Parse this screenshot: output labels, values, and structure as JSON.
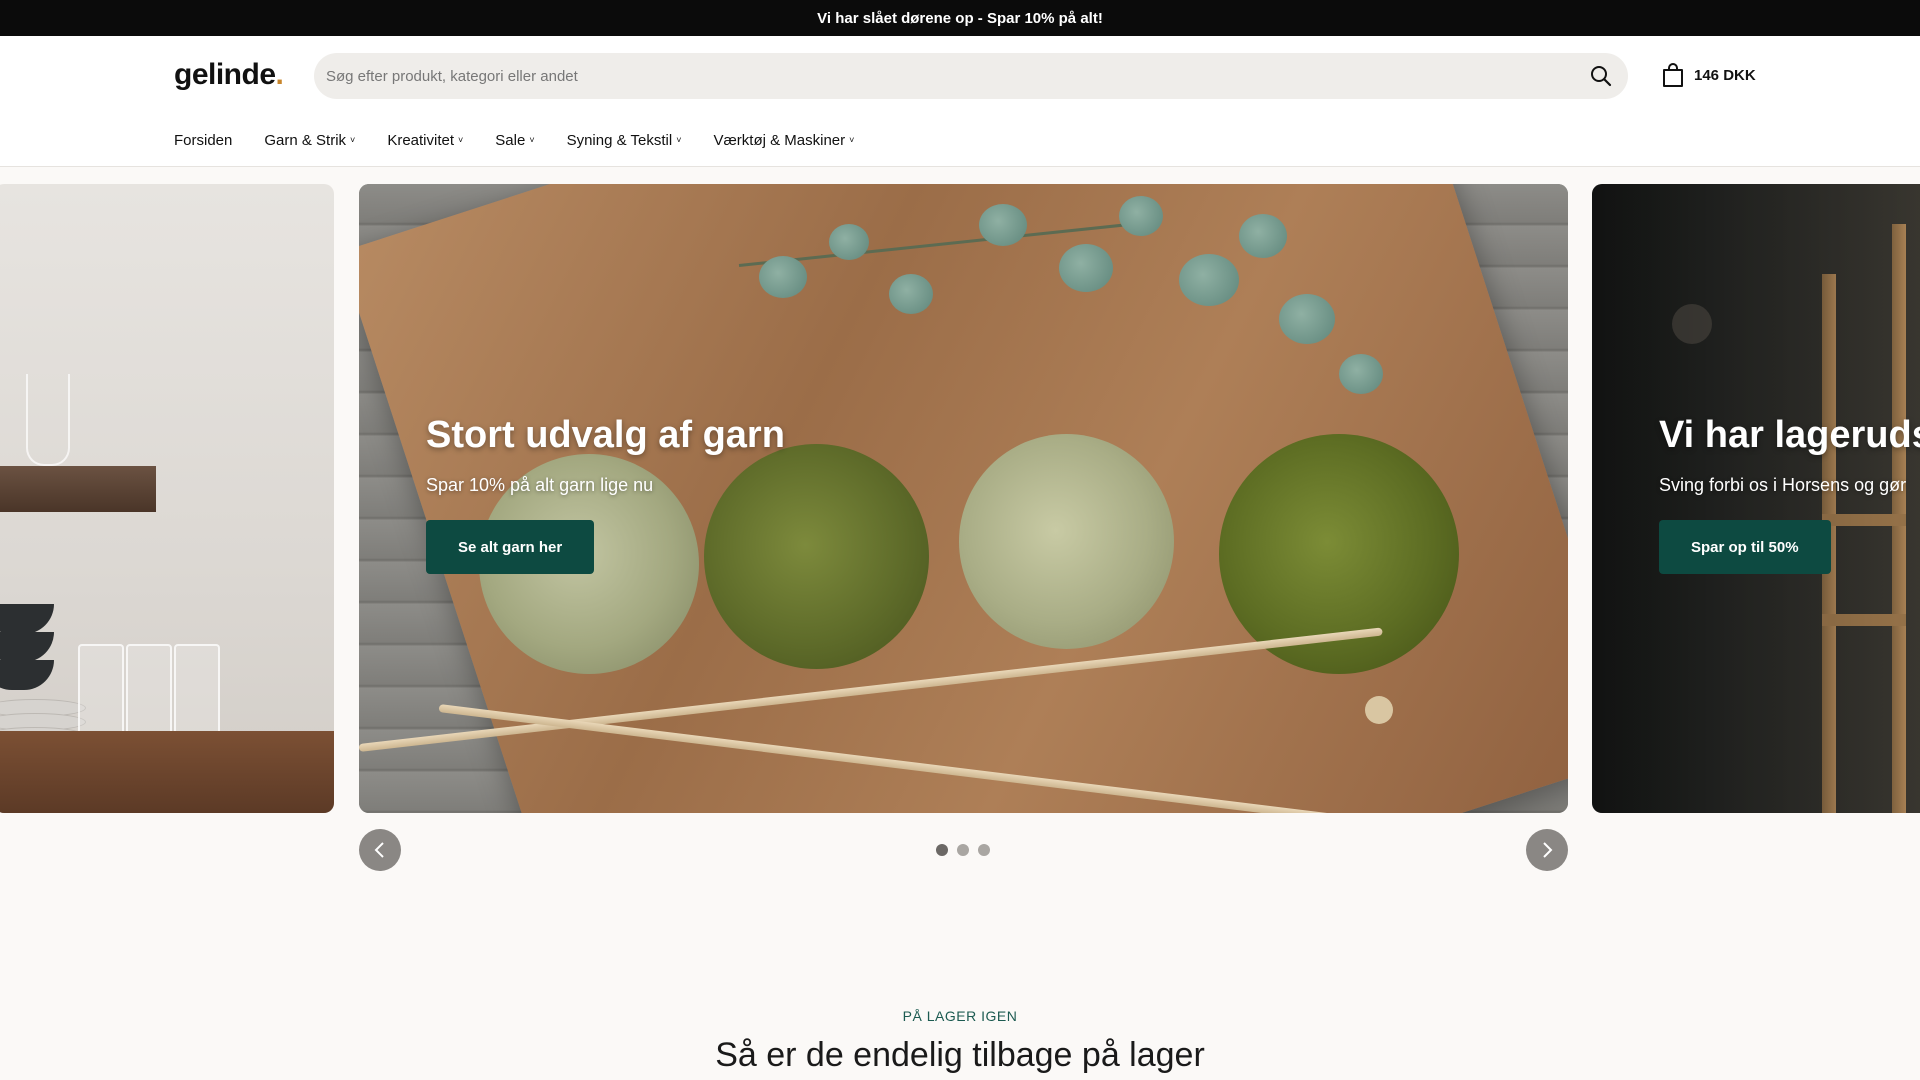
{
  "announcement": "Vi har slået dørene op - Spar 10% på alt!",
  "header": {
    "logo": "gelinde",
    "logo_dot": ".",
    "search_placeholder": "Søg efter produkt, kategori eller andet",
    "cart_total": "146 DKK"
  },
  "nav": [
    {
      "label": "Forsiden",
      "has_dropdown": false
    },
    {
      "label": "Garn & Strik",
      "has_dropdown": true
    },
    {
      "label": "Kreativitet",
      "has_dropdown": true
    },
    {
      "label": "Sale",
      "has_dropdown": true
    },
    {
      "label": "Syning & Tekstil",
      "has_dropdown": true
    },
    {
      "label": "Værktøj & Maskiner",
      "has_dropdown": true
    }
  ],
  "slides": {
    "main": {
      "title": "Stort udvalg af garn",
      "subtitle": "Spar 10% på alt garn lige nu",
      "button": "Se alt garn her"
    },
    "next": {
      "title": "Vi har lageruds",
      "subtitle": "Sving forbi os i Horsens og gør",
      "button": "Spar op til 50%"
    }
  },
  "carousel": {
    "dot_count": 3,
    "active_dot": 1
  },
  "section": {
    "eyebrow": "PÅ LAGER IGEN",
    "title": "Så er de endelig tilbage på lager"
  },
  "colors": {
    "accent": "#0d4a41",
    "eyebrow": "#1c5b51",
    "logo_dot": "#c8862c"
  }
}
